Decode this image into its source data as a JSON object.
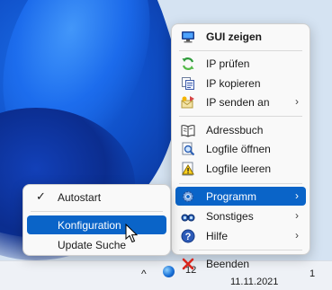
{
  "main_menu": {
    "items": [
      {
        "id": "gui",
        "label": "GUI zeigen",
        "icon": "monitor-icon",
        "bold": true
      },
      {
        "id": "ip-check",
        "label": "IP prüfen",
        "icon": "refresh-icon"
      },
      {
        "id": "ip-copy",
        "label": "IP kopieren",
        "icon": "copy-icon"
      },
      {
        "id": "ip-send",
        "label": "IP senden an",
        "icon": "send-icon",
        "submenu": true
      },
      {
        "id": "addressbook",
        "label": "Adressbuch",
        "icon": "book-icon"
      },
      {
        "id": "logfile-open",
        "label": "Logfile öffnen",
        "icon": "magnifier-icon"
      },
      {
        "id": "logfile-clear",
        "label": "Logfile leeren",
        "icon": "warning-icon"
      },
      {
        "id": "programm",
        "label": "Programm",
        "icon": "gear-icon",
        "submenu": true,
        "highlighted": true
      },
      {
        "id": "sonstiges",
        "label": "Sonstiges",
        "icon": "binoculars-icon",
        "submenu": true
      },
      {
        "id": "hilfe",
        "label": "Hilfe",
        "icon": "help-icon",
        "submenu": true
      },
      {
        "id": "beenden",
        "label": "Beenden",
        "icon": "close-x-icon"
      }
    ],
    "arrow": "›"
  },
  "sub_menu": {
    "items": [
      {
        "id": "autostart",
        "label": "Autostart",
        "checked": true
      },
      {
        "id": "konfiguration",
        "label": "Konfiguration",
        "highlighted": true
      },
      {
        "id": "update",
        "label": "Update Suche"
      }
    ],
    "check_glyph": "✓"
  },
  "taskbar": {
    "chevron": "^",
    "tray_text": "12",
    "date": "11.11.2021",
    "tray_end": "1"
  },
  "colors": {
    "highlight": "#0a64c8",
    "menu_bg": "#f9f9f9",
    "wallpaper": "#d5e3f2"
  }
}
